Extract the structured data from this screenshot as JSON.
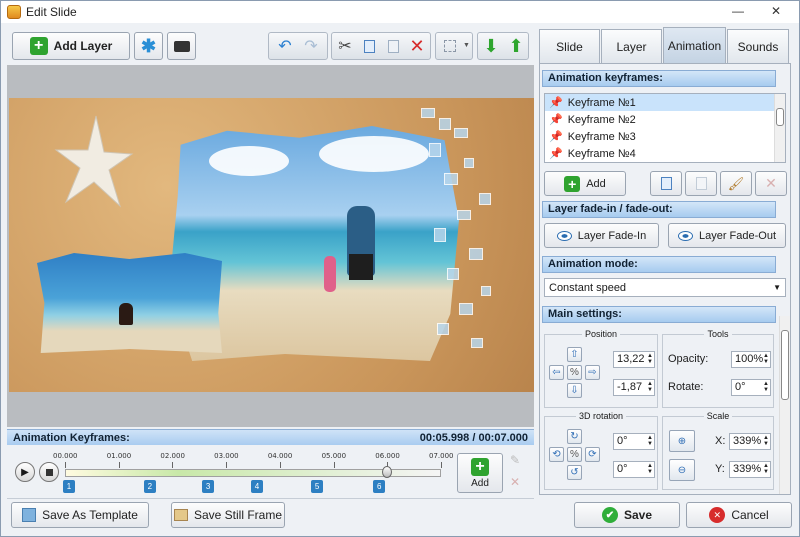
{
  "window": {
    "title": "Edit Slide",
    "minimize": "—",
    "close": "✕"
  },
  "toolbar": {
    "add_layer": "Add Layer"
  },
  "keyframes_bar": {
    "title": "Animation Keyframes:",
    "time": "00:05.998 / 00:07.000"
  },
  "timeline": {
    "ticks": [
      "00.000",
      "01.000",
      "02.000",
      "03.000",
      "04.000",
      "05.000",
      "06.000",
      "07.000"
    ],
    "markers": [
      "1",
      "2",
      "3",
      "4",
      "5",
      "6"
    ],
    "add_label": "Add",
    "playhead_fraction": 0.857
  },
  "bottom": {
    "save_template": "Save As Template",
    "save_frame": "Save Still Frame",
    "save": "Save",
    "cancel": "Cancel"
  },
  "tabs": [
    {
      "label": "Slide"
    },
    {
      "label": "Layer"
    },
    {
      "label": "Animation"
    },
    {
      "label": "Sounds"
    }
  ],
  "panel": {
    "keyframes_header": "Animation keyframes:",
    "keyframes": [
      "Keyframe №1",
      "Keyframe №2",
      "Keyframe №3",
      "Keyframe №4"
    ],
    "add_label": "Add",
    "fade_header": "Layer fade-in / fade-out:",
    "fade_in": "Layer Fade-In",
    "fade_out": "Layer Fade-Out",
    "mode_header": "Animation mode:",
    "mode_value": "Constant speed",
    "main_header": "Main settings:",
    "position_title": "Position",
    "pos_x": "13,22",
    "pos_y": "-1,87",
    "tools_title": "Tools",
    "opacity_label": "Opacity:",
    "opacity_value": "100%",
    "rotate_label": "Rotate:",
    "rotate_value": "0°",
    "rotation3d_title": "3D rotation",
    "rot3d_a": "0°",
    "rot3d_b": "0°",
    "scale_title": "Scale",
    "scale_x_label": "X:",
    "scale_x": "339%",
    "scale_y_label": "Y:",
    "scale_y": "339%"
  }
}
